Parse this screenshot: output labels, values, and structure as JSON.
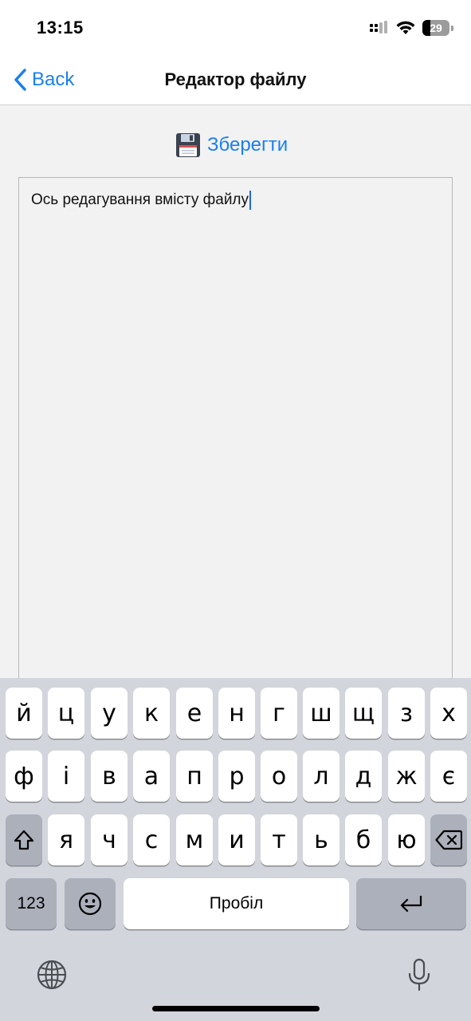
{
  "status": {
    "time": "13:15",
    "battery": "29"
  },
  "nav": {
    "back_label": "Back",
    "title": "Редактор файлу"
  },
  "toolbar": {
    "save_label": "Зберегти"
  },
  "editor": {
    "text": "Ось редагування вмісту файлу"
  },
  "keyboard": {
    "row1": [
      "й",
      "ц",
      "у",
      "к",
      "е",
      "н",
      "г",
      "ш",
      "щ",
      "з",
      "х"
    ],
    "row2": [
      "ф",
      "і",
      "в",
      "а",
      "п",
      "р",
      "о",
      "л",
      "д",
      "ж",
      "є"
    ],
    "row3": [
      "я",
      "ч",
      "с",
      "м",
      "и",
      "т",
      "ь",
      "б",
      "ю"
    ],
    "numbers_label": "123",
    "space_label": "Пробіл"
  },
  "icons": [
    "back-chevron-icon",
    "floppy-disk-icon",
    "signal-icon",
    "wifi-icon",
    "battery-icon",
    "shift-icon",
    "backspace-icon",
    "emoji-icon",
    "return-icon",
    "globe-icon",
    "microphone-icon"
  ]
}
